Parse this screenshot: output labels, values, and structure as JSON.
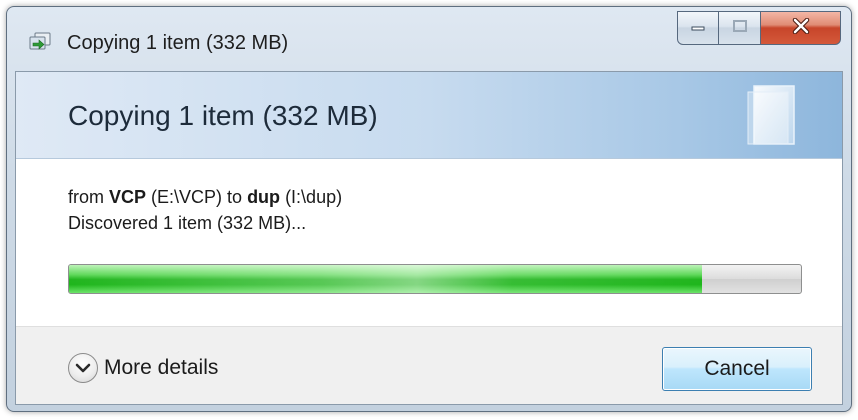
{
  "window": {
    "title": "Copying 1 item (332 MB)"
  },
  "header": {
    "title": "Copying 1 item (332 MB)"
  },
  "transfer": {
    "from_prefix": "from ",
    "source_name": "VCP",
    "source_path": " (E:\\VCP) to ",
    "dest_name": "dup",
    "dest_path": " (I:\\dup)",
    "status": "Discovered 1 item (332 MB)..."
  },
  "progress": {
    "fraction": 0.865,
    "colors": {
      "fill": "#22b51f",
      "track": "#dcdcdc"
    }
  },
  "footer": {
    "details_label": "More details",
    "details_icon": "chevron-down-icon",
    "cancel_label": "Cancel"
  },
  "icons": {
    "title": "copy-files-icon",
    "minimize": "minimize-icon",
    "maximize": "maximize-icon",
    "close": "close-icon",
    "header": "document-icon"
  }
}
